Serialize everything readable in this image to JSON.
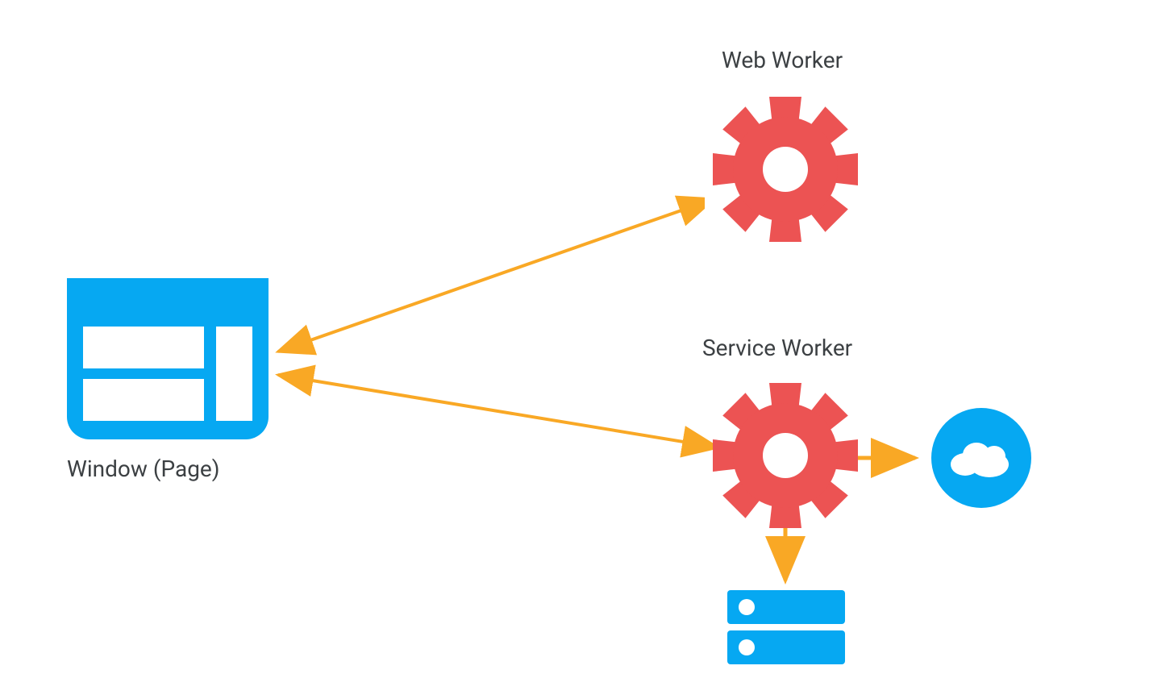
{
  "labels": {
    "window_page": "Window (Page)",
    "web_worker": "Web Worker",
    "service_worker": "Service Worker"
  },
  "colors": {
    "blue": "#06a8f2",
    "red": "#ec5353",
    "orange": "#f9a825",
    "white": "#ffffff",
    "text": "#3c4043"
  },
  "nodes": [
    {
      "id": "window",
      "type": "browser-window",
      "label_ref": "window_page"
    },
    {
      "id": "web-worker",
      "type": "gear",
      "label_ref": "web_worker"
    },
    {
      "id": "service-worker",
      "type": "gear",
      "label_ref": "service_worker"
    },
    {
      "id": "cloud",
      "type": "cloud"
    },
    {
      "id": "database",
      "type": "server-stack"
    }
  ],
  "edges": [
    {
      "from": "window",
      "to": "web-worker",
      "bidirectional": true
    },
    {
      "from": "window",
      "to": "service-worker",
      "bidirectional": true
    },
    {
      "from": "service-worker",
      "to": "cloud",
      "bidirectional": false
    },
    {
      "from": "service-worker",
      "to": "database",
      "bidirectional": false
    }
  ]
}
